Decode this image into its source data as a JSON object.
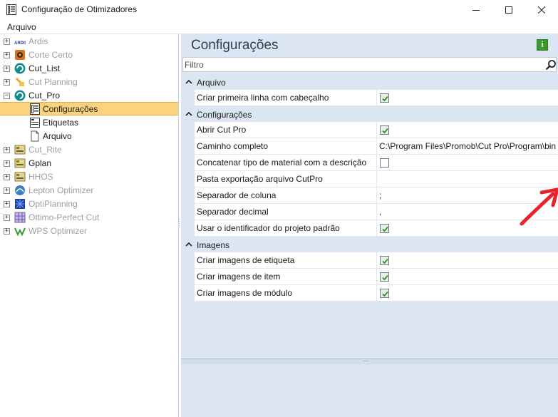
{
  "window": {
    "title": "Configuração de Otimizadores"
  },
  "menu": {
    "file": "Arquivo"
  },
  "tree": {
    "items": [
      {
        "label": "Ardis",
        "dim": true
      },
      {
        "label": "Corte Certo",
        "dim": true
      },
      {
        "label": "Cut_List",
        "dim": false
      },
      {
        "label": "Cut Planning",
        "dim": true
      },
      {
        "label": "Cut_Pro",
        "dim": false,
        "expanded": true
      },
      {
        "label": "Configurações",
        "dim": false,
        "selected": true
      },
      {
        "label": "Etiquetas",
        "dim": false
      },
      {
        "label": "Arquivo",
        "dim": false
      },
      {
        "label": "Cut_Rite",
        "dim": true
      },
      {
        "label": "Gplan",
        "dim": false
      },
      {
        "label": "HHOS",
        "dim": true
      },
      {
        "label": "Lepton Optimizer",
        "dim": true
      },
      {
        "label": "OptiPlanning",
        "dim": true
      },
      {
        "label": "Ottimo-Perfect Cut",
        "dim": true
      },
      {
        "label": "WPS Optimizer",
        "dim": true
      }
    ],
    "ardis_logo_text": "ARDIS"
  },
  "panel": {
    "title": "Configurações",
    "info_label": "i"
  },
  "filter": {
    "placeholder": "Filtro"
  },
  "categories": [
    {
      "label": "Arquivo",
      "props": [
        {
          "name": "Criar primeira linha com cabeçalho",
          "type": "checkbox",
          "checked": true
        }
      ]
    },
    {
      "label": "Configurações",
      "props": [
        {
          "name": "Abrir Cut Pro",
          "type": "checkbox",
          "checked": true
        },
        {
          "name": "Caminho completo",
          "type": "text",
          "value": "C:\\Program Files\\Promob\\Cut Pro\\Program\\bin"
        },
        {
          "name": "Concatenar tipo de material com a descrição",
          "type": "checkbox",
          "checked": false
        },
        {
          "name": "Pasta exportação arquivo CutPro",
          "type": "text",
          "value": ""
        },
        {
          "name": "Separador de coluna",
          "type": "text",
          "value": ";"
        },
        {
          "name": "Separador decimal",
          "type": "text",
          "value": ","
        },
        {
          "name": "Usar o identificador do projeto padrão",
          "type": "checkbox",
          "checked": true
        }
      ]
    },
    {
      "label": "Imagens",
      "props": [
        {
          "name": "Criar imagens de etiqueta",
          "type": "checkbox",
          "checked": true
        },
        {
          "name": "Criar imagens de item",
          "type": "checkbox",
          "checked": true
        },
        {
          "name": "Criar imagens de módulo",
          "type": "checkbox",
          "checked": true
        }
      ]
    }
  ],
  "colors": {
    "selection": "#fbd37e",
    "panel_bg": "#dce6f2",
    "check_green": "#3a8a2e",
    "annotation_arrow": "#e8232b"
  }
}
